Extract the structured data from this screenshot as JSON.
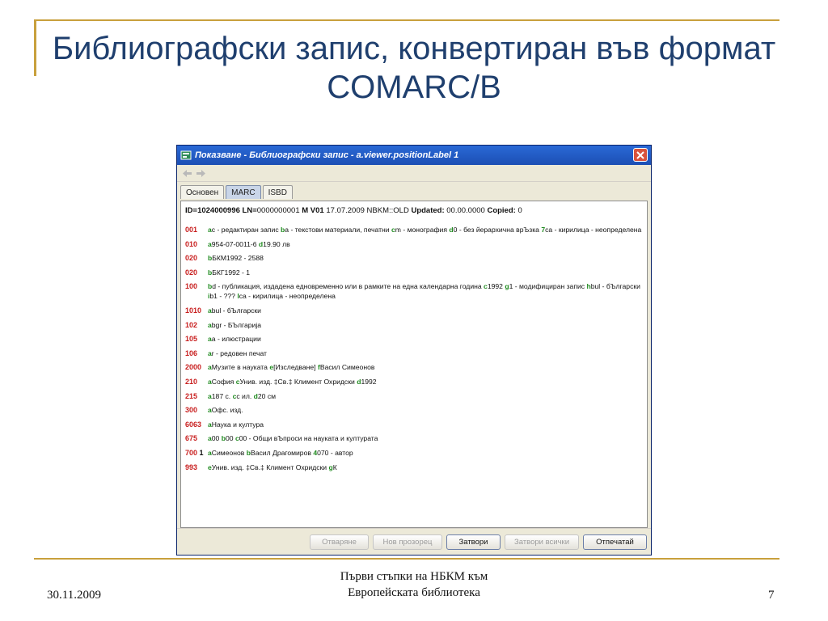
{
  "slide": {
    "title_line1": "Библиографски запис, конвертиран във формат",
    "title_line2": "COMARC/B",
    "date": "30.11.2009",
    "footer_line1": "Първи стъпки на НБКМ към",
    "footer_line2": "Европейската библиотека",
    "page_number": "7"
  },
  "window": {
    "title": "Показване - Библиографски запис - a.viewer.positionLabel 1",
    "tabs": [
      {
        "label": "Основен",
        "active": false
      },
      {
        "label": "MARC",
        "active": true
      },
      {
        "label": "ISBD",
        "active": false
      }
    ],
    "header": {
      "id_label": "ID=",
      "id_value": "1024000996",
      "ln_label": "LN=",
      "ln_value": "0000000001",
      "mv_label": "M V01",
      "date": "17.07.2009 NBKM::OLD",
      "updated_label": "Updated:",
      "updated_value": "00.00.0000",
      "copied_label": "Copied:",
      "copied_value": "0"
    },
    "records": [
      {
        "tag": "001",
        "ind": "",
        "parts": [
          [
            "a",
            "c - редактиран запис "
          ],
          [
            "b",
            "a - текстови материали, печатни "
          ],
          [
            "c",
            "m - монография "
          ],
          [
            "d",
            "0 - без йерархична врЪзка "
          ],
          [
            "7",
            "ca - кирилица - неопределена"
          ]
        ]
      },
      {
        "tag": "010",
        "ind": "",
        "parts": [
          [
            "a",
            "954-07-0011-6 "
          ],
          [
            "d",
            "19.90 лв"
          ]
        ]
      },
      {
        "tag": "020",
        "ind": "",
        "parts": [
          [
            "b",
            "БКМ1992 - 2588"
          ]
        ]
      },
      {
        "tag": "020",
        "ind": "",
        "parts": [
          [
            "b",
            "БКГ1992 - 1"
          ]
        ]
      },
      {
        "tag": "100",
        "ind": "",
        "parts": [
          [
            "b",
            "d - публикация, издадена едновременно или в рамките на една календарна година "
          ],
          [
            "c",
            "1992 "
          ],
          [
            "g",
            "1 - модифициран запис "
          ],
          [
            "h",
            "bul - бЪлгарски "
          ],
          [
            "i",
            "b1 - ??? "
          ],
          [
            "l",
            "ca - кирилица - неопределена"
          ]
        ]
      },
      {
        "tag": "101",
        "ind": "0",
        "parts": [
          [
            "a",
            "bul - бЪлгарски"
          ]
        ]
      },
      {
        "tag": "102",
        "ind": "",
        "parts": [
          [
            "a",
            "bgr - БЪлгарија"
          ]
        ]
      },
      {
        "tag": "105",
        "ind": "",
        "parts": [
          [
            "a",
            "a - илюстрации"
          ]
        ]
      },
      {
        "tag": "106",
        "ind": "",
        "parts": [
          [
            "a",
            "r - редовен печат"
          ]
        ]
      },
      {
        "tag": "200",
        "ind": "0",
        "parts": [
          [
            "a",
            "Музите в науката "
          ],
          [
            "e",
            "[Изследване] "
          ],
          [
            "f",
            "Васил Симеонов"
          ]
        ]
      },
      {
        "tag": "210",
        "ind": "",
        "parts": [
          [
            "a",
            "София "
          ],
          [
            "c",
            "Унив. изд. ‡Св.‡ Климент Охридски "
          ],
          [
            "d",
            "1992"
          ]
        ]
      },
      {
        "tag": "215",
        "ind": "",
        "parts": [
          [
            "a",
            "187 с. "
          ],
          [
            "c",
            "с ил. "
          ],
          [
            "d",
            "20 см"
          ]
        ]
      },
      {
        "tag": "300",
        "ind": "",
        "parts": [
          [
            "a",
            "Офс. изд."
          ]
        ]
      },
      {
        "tag": "606",
        "ind": "3",
        "parts": [
          [
            "a",
            "Наука и култура"
          ]
        ]
      },
      {
        "tag": "675",
        "ind": "",
        "parts": [
          [
            "a",
            "00 "
          ],
          [
            "b",
            "00 "
          ],
          [
            "c",
            "00 - Общи вЪпроси на науката и културата"
          ]
        ]
      },
      {
        "tag": "700",
        "ind": " 1",
        "parts": [
          [
            "a",
            "Симеонов "
          ],
          [
            "b",
            "Васил Драгомиров "
          ],
          [
            "4",
            "070 - автор"
          ]
        ]
      },
      {
        "tag": "993",
        "ind": "",
        "parts": [
          [
            "e",
            "Унив. изд. ‡Св.‡ Климент Охридски "
          ],
          [
            "g",
            "К"
          ]
        ]
      }
    ],
    "buttons": [
      {
        "label": "Отваряне",
        "enabled": false
      },
      {
        "label": "Нов прозорец",
        "enabled": false
      },
      {
        "label": "Затвори",
        "enabled": true
      },
      {
        "label": "Затвори всички",
        "enabled": false
      },
      {
        "label": "Отпечатай",
        "enabled": true
      }
    ],
    "colors": {
      "tag": "#c81e1e",
      "subfield": "#1e8a1e",
      "titlebar": "#2a69d6"
    }
  }
}
